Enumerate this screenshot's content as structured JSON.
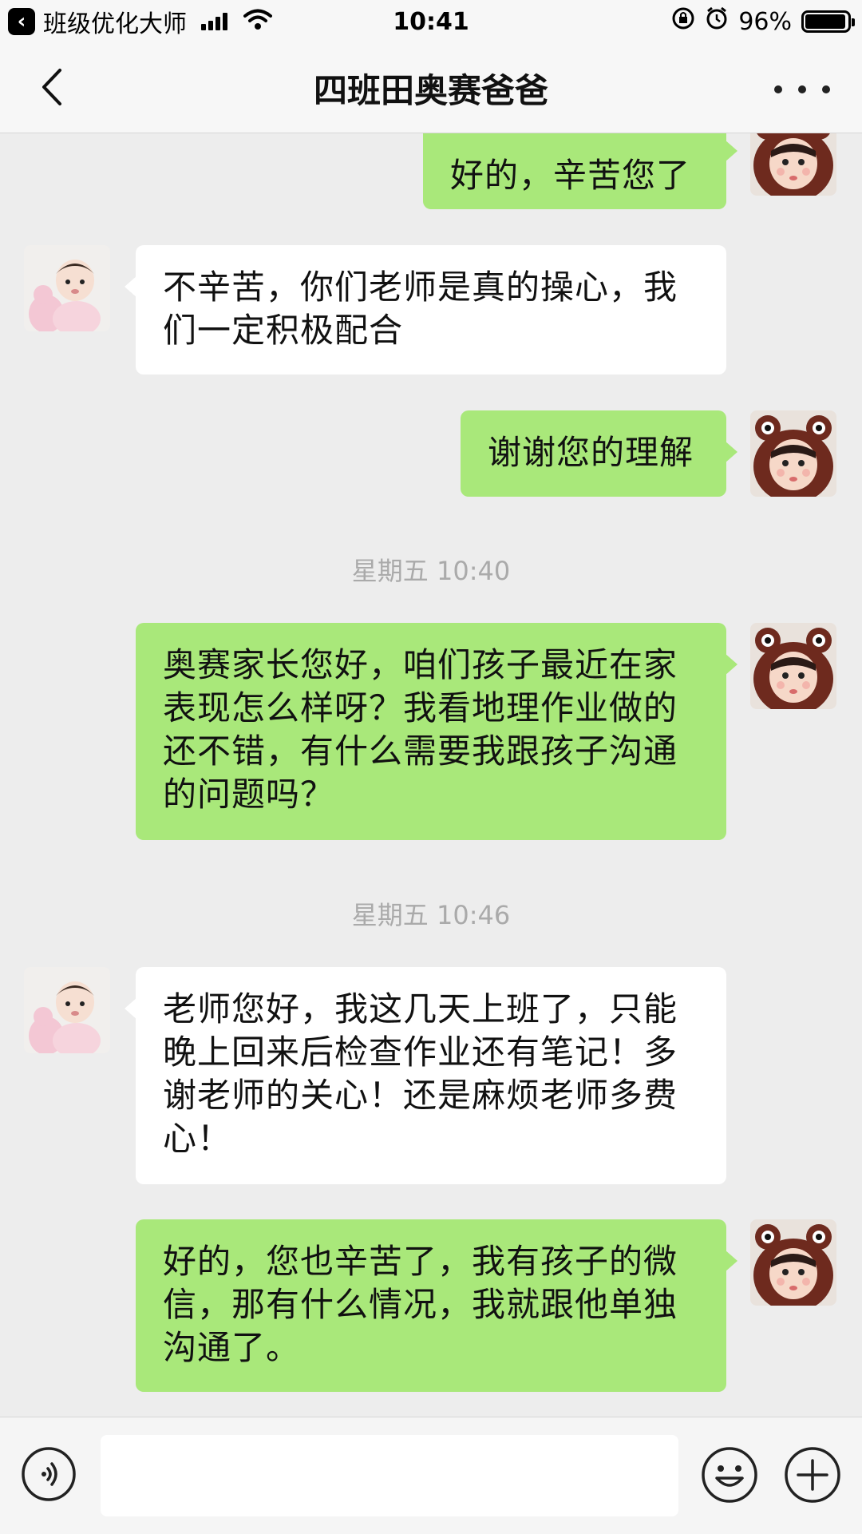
{
  "status_bar": {
    "back_app_name": "班级优化大师",
    "time": "10:41",
    "battery_percent": "96%",
    "battery_level": 0.96
  },
  "nav": {
    "title": "四班田奥赛爸爸"
  },
  "messages": [
    {
      "sender": "me",
      "text": "好的，辛苦您了"
    },
    {
      "sender": "other",
      "text": "不辛苦，你们老师是真的操心，我们一定积极配合"
    },
    {
      "sender": "me",
      "text": "谢谢您的理解"
    },
    {
      "timestamp": "星期五 10:40"
    },
    {
      "sender": "me",
      "text": "奥赛家长您好，咱们孩子最近在家表现怎么样呀？我看地理作业做的还不错，有什么需要我跟孩子沟通的问题吗？"
    },
    {
      "timestamp": "星期五 10:46"
    },
    {
      "sender": "other",
      "text": "老师您好，我这几天上班了，只能晚上回来后检查作业还有笔记！多谢老师的关心！还是麻烦老师多费心！"
    },
    {
      "sender": "me",
      "text": "好的，您也辛苦了，我有孩子的微信，那有什么情况，我就跟他单独沟通了。"
    }
  ],
  "input": {
    "value": "",
    "placeholder": ""
  },
  "icons": {
    "back": "chevron-left-icon",
    "more": "more-icon",
    "voice": "voice-icon",
    "emoji": "emoji-icon",
    "plus": "plus-icon"
  },
  "colors": {
    "my_bubble": "#a9e87a",
    "other_bubble": "#ffffff",
    "background": "#ededed"
  }
}
